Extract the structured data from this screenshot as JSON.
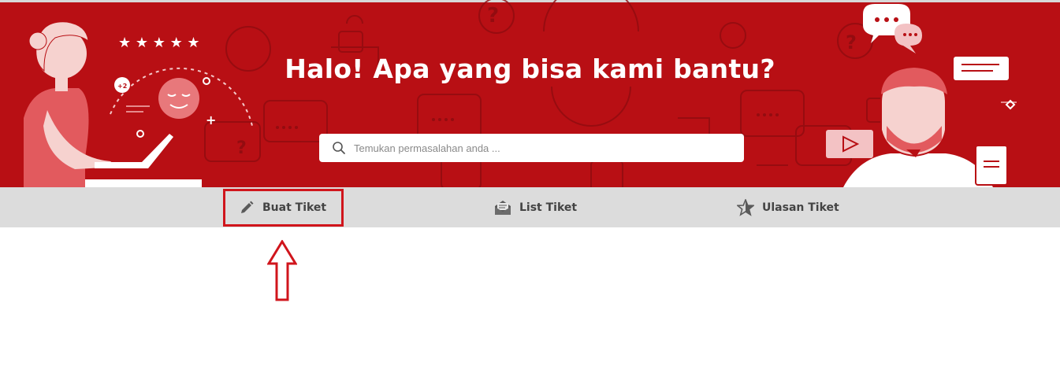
{
  "hero": {
    "title": "Halo! Apa yang bisa kami bantu?",
    "bg_color": "#b80f14"
  },
  "search": {
    "placeholder": "Temukan permasalahan anda ..."
  },
  "nav": {
    "items": [
      {
        "label": "Buat Tiket",
        "icon": "pencil-icon"
      },
      {
        "label": "List Tiket",
        "icon": "envelope-open-icon"
      },
      {
        "label": "Ulasan Tiket",
        "icon": "star-icon"
      }
    ]
  },
  "annotation": {
    "highlight_color": "#d0151c",
    "target": "Buat Tiket"
  },
  "illustration": {
    "badge_text": "+2"
  }
}
